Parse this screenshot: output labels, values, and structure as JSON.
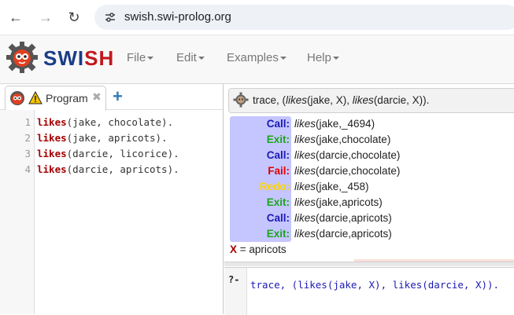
{
  "browser": {
    "url": "swish.swi-prolog.org",
    "nav_icons": [
      "back-arrow-icon",
      "forward-arrow-icon",
      "reload-icon",
      "site-info-icon"
    ]
  },
  "navbar": {
    "brand_part1": "SWI",
    "brand_part2": "SH",
    "menus": [
      "File",
      "Edit",
      "Examples",
      "Help"
    ]
  },
  "editor": {
    "tab_label": "Program",
    "tab_close": "✖",
    "add_tab": "+",
    "lines": [
      {
        "num": "1",
        "pred": "likes",
        "args": "(jake, chocolate)."
      },
      {
        "num": "2",
        "pred": "likes",
        "args": "(jake, apricots)."
      },
      {
        "num": "3",
        "pred": "likes",
        "args": "(darcie, licorice)."
      },
      {
        "num": "4",
        "pred": "likes",
        "args": "(darcie, apricots)."
      }
    ]
  },
  "trace": {
    "query_prefix": "trace, (",
    "q_pred1": "likes",
    "q_args1": "(jake, X), ",
    "q_pred2": "likes",
    "q_args2": "(darcie, X)).",
    "steps": [
      {
        "port": "Call:",
        "color": "#1a1ab3",
        "pred": "likes",
        "args": "(jake,_4694)"
      },
      {
        "port": "Exit:",
        "color": "#1aa51a",
        "pred": "likes",
        "args": "(jake,chocolate)"
      },
      {
        "port": "Call:",
        "color": "#1a1ab3",
        "pred": "likes",
        "args": "(darcie,chocolate)"
      },
      {
        "port": "Fail:",
        "color": "#e00000",
        "pred": "likes",
        "args": "(darcie,chocolate)"
      },
      {
        "port": "Redo:",
        "color": "#ffd500",
        "pred": "likes",
        "args": "(jake,_458)"
      },
      {
        "port": "Exit:",
        "color": "#1aa51a",
        "pred": "likes",
        "args": "(jake,apricots)"
      },
      {
        "port": "Call:",
        "color": "#1a1ab3",
        "pred": "likes",
        "args": "(darcie,apricots)"
      },
      {
        "port": "Exit:",
        "color": "#1aa51a",
        "pred": "likes",
        "args": "(darcie,apricots)"
      }
    ],
    "answer_var": "X",
    "answer_rest": " = apricots"
  },
  "query": {
    "prompt": "?-",
    "text": "trace, (likes(jake, X), likes(darcie, X))."
  }
}
